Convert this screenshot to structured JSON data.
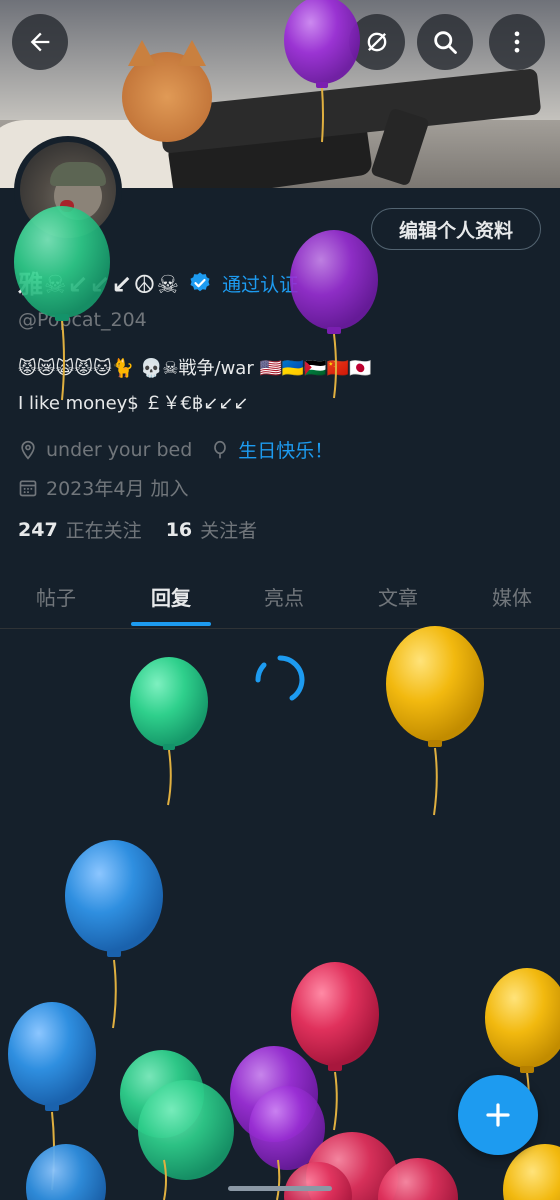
{
  "header": {
    "back_icon": "arrow-left-icon",
    "actions": [
      "no-sync-icon",
      "search-icon",
      "more-vertical-icon"
    ]
  },
  "profile": {
    "edit_label": "编辑个人资料",
    "display_name": "雅☠↙↙↙☮☠",
    "verify_label": "通过认证",
    "handle": "@Popcat_204",
    "bio_line1": "😾😿🙀😾🐱🐈 💀☠戦争/war 🇺🇸🇺🇦🇵🇸🇨🇳🇯🇵",
    "bio_line2": "I like money$ ￡￥€฿↙↙↙",
    "location": "under your bed",
    "birthday": "生日快乐！",
    "joined": "2023年4月 加入",
    "following_count": "247",
    "following_label": "正在关注",
    "followers_count": "16",
    "followers_label": "关注者"
  },
  "tabs": [
    {
      "label": "帖子",
      "active": false
    },
    {
      "label": "回复",
      "active": true
    },
    {
      "label": "亮点",
      "active": false
    },
    {
      "label": "文章",
      "active": false
    },
    {
      "label": "媒体",
      "active": false
    }
  ],
  "colors": {
    "background": "#15202b",
    "accent": "#1d9bf0",
    "muted": "#71767b",
    "balloon_green": "#2fd08c",
    "balloon_purple": "#9b2fd6",
    "balloon_yellow": "#f2b90f",
    "balloon_blue": "#2f8fe0",
    "balloon_red": "#e0315c"
  },
  "fab": {
    "icon": "plus-icon"
  }
}
